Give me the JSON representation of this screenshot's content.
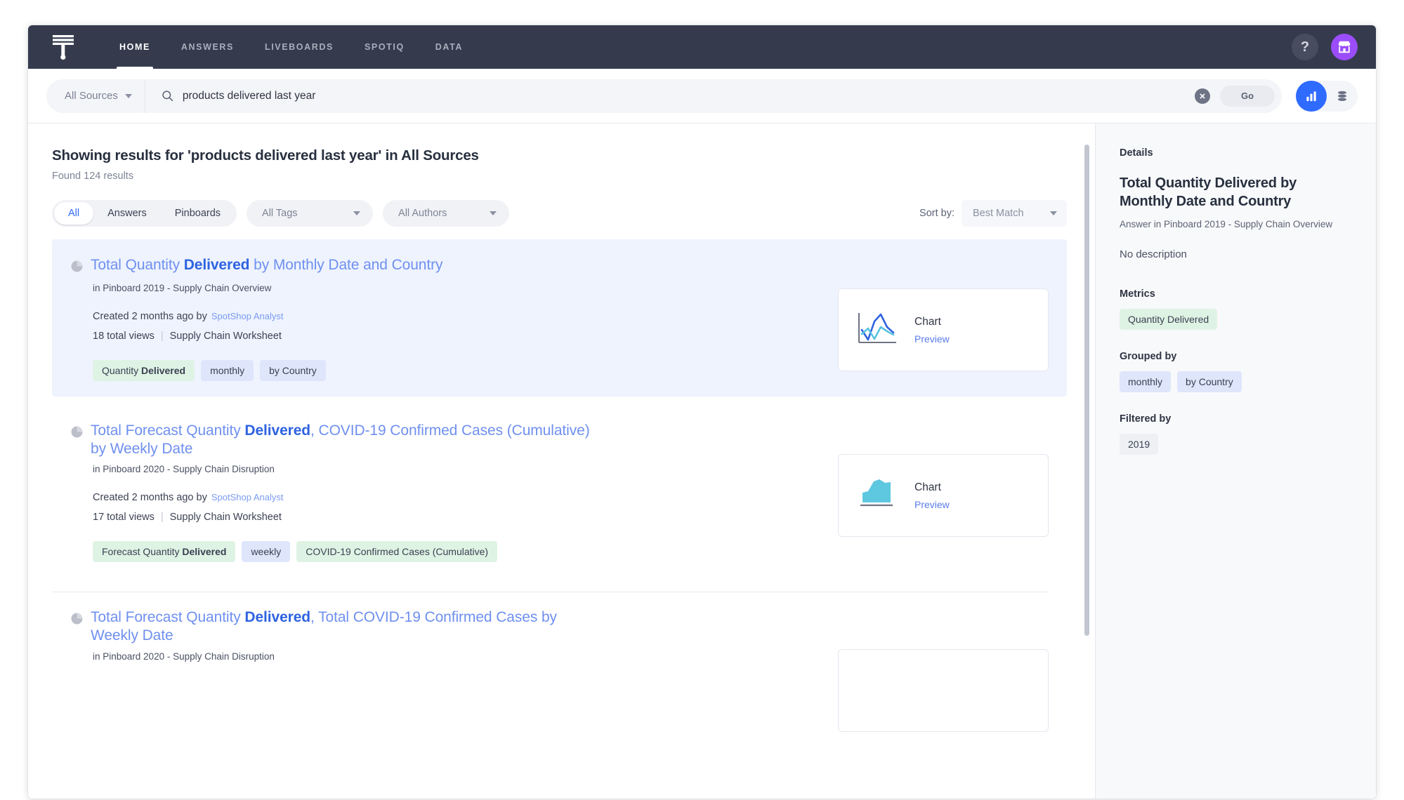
{
  "nav": {
    "logo_icon": "thoughtspot-logo-icon",
    "items": [
      {
        "label": "HOME",
        "active": true
      },
      {
        "label": "ANSWERS",
        "active": false
      },
      {
        "label": "LIVEBOARDS",
        "active": false
      },
      {
        "label": "SPOTIQ",
        "active": false
      },
      {
        "label": "DATA",
        "active": false
      }
    ],
    "help_label": "?",
    "avatar_icon": "store-icon",
    "bg_color": "#353b4d",
    "avatar_color": "#9b4dfb"
  },
  "search": {
    "source_label": "All Sources",
    "query": "products delivered last year",
    "placeholder": "Search",
    "clear_icon": "clear-circle-icon",
    "go_label": "Go",
    "chart_view_icon": "bar-chart-icon",
    "table_view_icon": "data-stack-icon",
    "accent_color": "#2f6bff"
  },
  "results_header": {
    "title": "Showing results for 'products delivered last year' in All Sources",
    "count": "Found 124 results"
  },
  "filters": {
    "segments": [
      {
        "label": "All",
        "active": true
      },
      {
        "label": "Answers",
        "active": false
      },
      {
        "label": "Pinboards",
        "active": false
      }
    ],
    "tags_dropdown": "All Tags",
    "authors_dropdown": "All Authors",
    "sort_label": "Sort by:",
    "sort_value": "Best Match"
  },
  "results": [
    {
      "selected": true,
      "icon": "pie-chart-icon",
      "title_parts": [
        {
          "text": "Total Quantity ",
          "bold": false
        },
        {
          "text": "Delivered",
          "bold": true
        },
        {
          "text": " by Monthly Date and Country",
          "bold": false
        }
      ],
      "subtitle": "in Pinboard 2019 - Supply Chain Overview",
      "created": "Created 2 months ago by",
      "author": "SpotShop Analyst",
      "views": "18 total views",
      "worksheet": "Supply Chain Worksheet",
      "chips": [
        {
          "label": "Quantity Delivered",
          "bold_part": "Delivered",
          "type": "metric"
        },
        {
          "label": "monthly",
          "bold_part": "",
          "type": "attr"
        },
        {
          "label": "by Country",
          "bold_part": "",
          "type": "attr"
        }
      ],
      "preview": {
        "title": "Chart",
        "link": "Preview",
        "icon": "line-chart-icon"
      }
    },
    {
      "selected": false,
      "icon": "pie-chart-icon",
      "title_parts": [
        {
          "text": "Total Forecast Quantity ",
          "bold": false
        },
        {
          "text": "Delivered",
          "bold": true
        },
        {
          "text": ", COVID-19 Confirmed Cases (Cumulative) by Weekly Date",
          "bold": false
        }
      ],
      "subtitle": "in Pinboard 2020 - Supply Chain Disruption",
      "created": "Created 2 months ago by",
      "author": "SpotShop Analyst",
      "views": "17 total views",
      "worksheet": "Supply Chain Worksheet",
      "chips": [
        {
          "label": "Forecast Quantity Delivered",
          "bold_part": "Delivered",
          "type": "metric"
        },
        {
          "label": "weekly",
          "bold_part": "",
          "type": "attr"
        },
        {
          "label": "COVID-19 Confirmed Cases (Cumulative)",
          "bold_part": "",
          "type": "metric"
        }
      ],
      "preview": {
        "title": "Chart",
        "link": "Preview",
        "icon": "area-chart-icon"
      }
    },
    {
      "selected": false,
      "icon": "pie-chart-icon",
      "title_parts": [
        {
          "text": "Total Forecast Quantity ",
          "bold": false
        },
        {
          "text": "Delivered",
          "bold": true
        },
        {
          "text": ", Total COVID-19 Confirmed Cases by Weekly Date",
          "bold": false
        }
      ],
      "subtitle": "in Pinboard 2020 - Supply Chain Disruption",
      "created": "",
      "author": "",
      "views": "",
      "worksheet": "",
      "chips": [],
      "preview": {
        "title": "",
        "link": "",
        "icon": "line-chart-icon"
      }
    }
  ],
  "details": {
    "panel_label": "Details",
    "title": "Total Quantity Delivered by Monthly Date and Country",
    "subtitle": "Answer in Pinboard 2019 - Supply Chain Overview",
    "description": "No description",
    "metrics_label": "Metrics",
    "metrics": [
      "Quantity Delivered"
    ],
    "grouped_label": "Grouped by",
    "grouped": [
      "monthly",
      "by Country"
    ],
    "filtered_label": "Filtered by",
    "filtered": [
      "2019"
    ]
  }
}
